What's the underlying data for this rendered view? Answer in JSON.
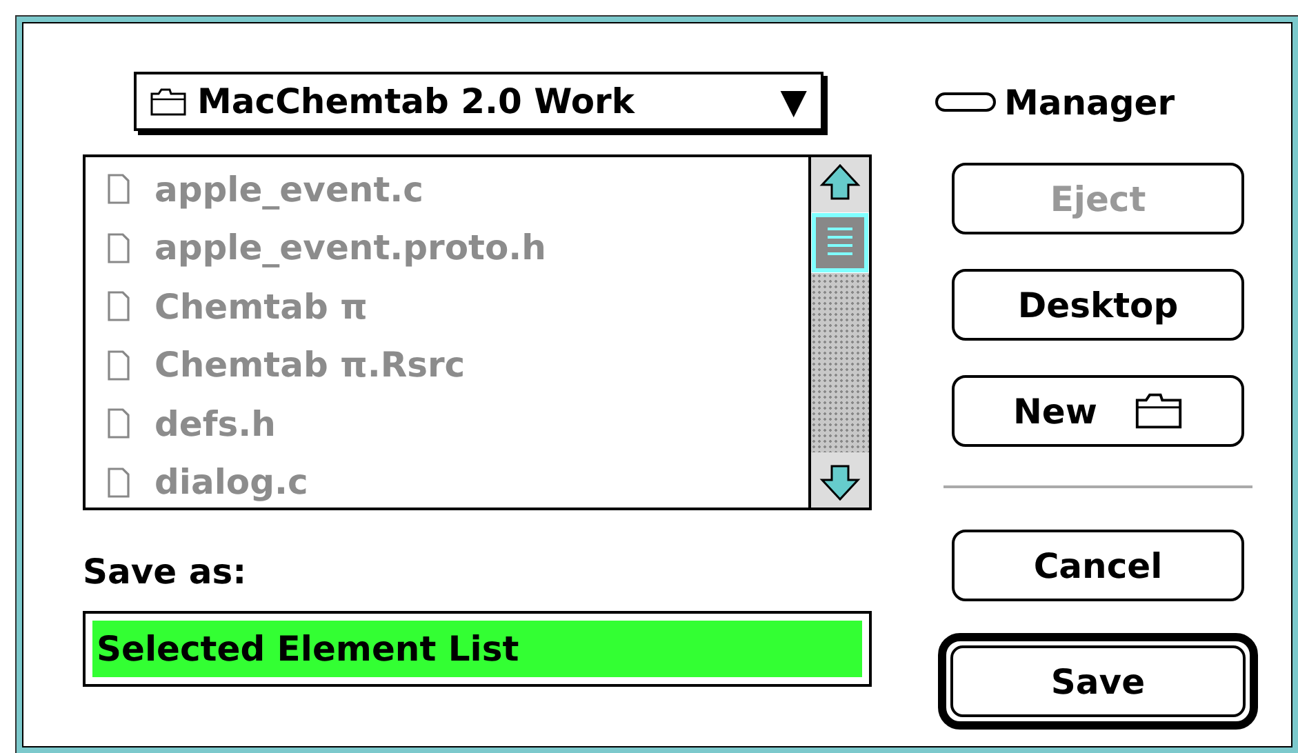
{
  "popup": {
    "label": "MacChemtab 2.0 Work",
    "arrow": "▼"
  },
  "volume": {
    "label": "Manager"
  },
  "files": [
    {
      "name": "apple_event.c",
      "disabled": true
    },
    {
      "name": "apple_event.proto.h",
      "disabled": true
    },
    {
      "name": "Chemtab π",
      "disabled": true
    },
    {
      "name": "Chemtab π.Rsrc",
      "disabled": true
    },
    {
      "name": "defs.h",
      "disabled": true
    },
    {
      "name": "dialog.c",
      "disabled": true
    }
  ],
  "save_as": {
    "label": "Save as:",
    "value": "Selected Element List",
    "selected": true
  },
  "buttons": [
    {
      "label": "Eject",
      "kind": "text",
      "disabled": true
    },
    {
      "label": "Desktop",
      "kind": "text",
      "disabled": false
    },
    {
      "label": "New",
      "kind": "folder",
      "disabled": false
    }
  ],
  "actions": [
    {
      "label": "Cancel",
      "default": false
    },
    {
      "label": "Save",
      "default": true
    }
  ]
}
